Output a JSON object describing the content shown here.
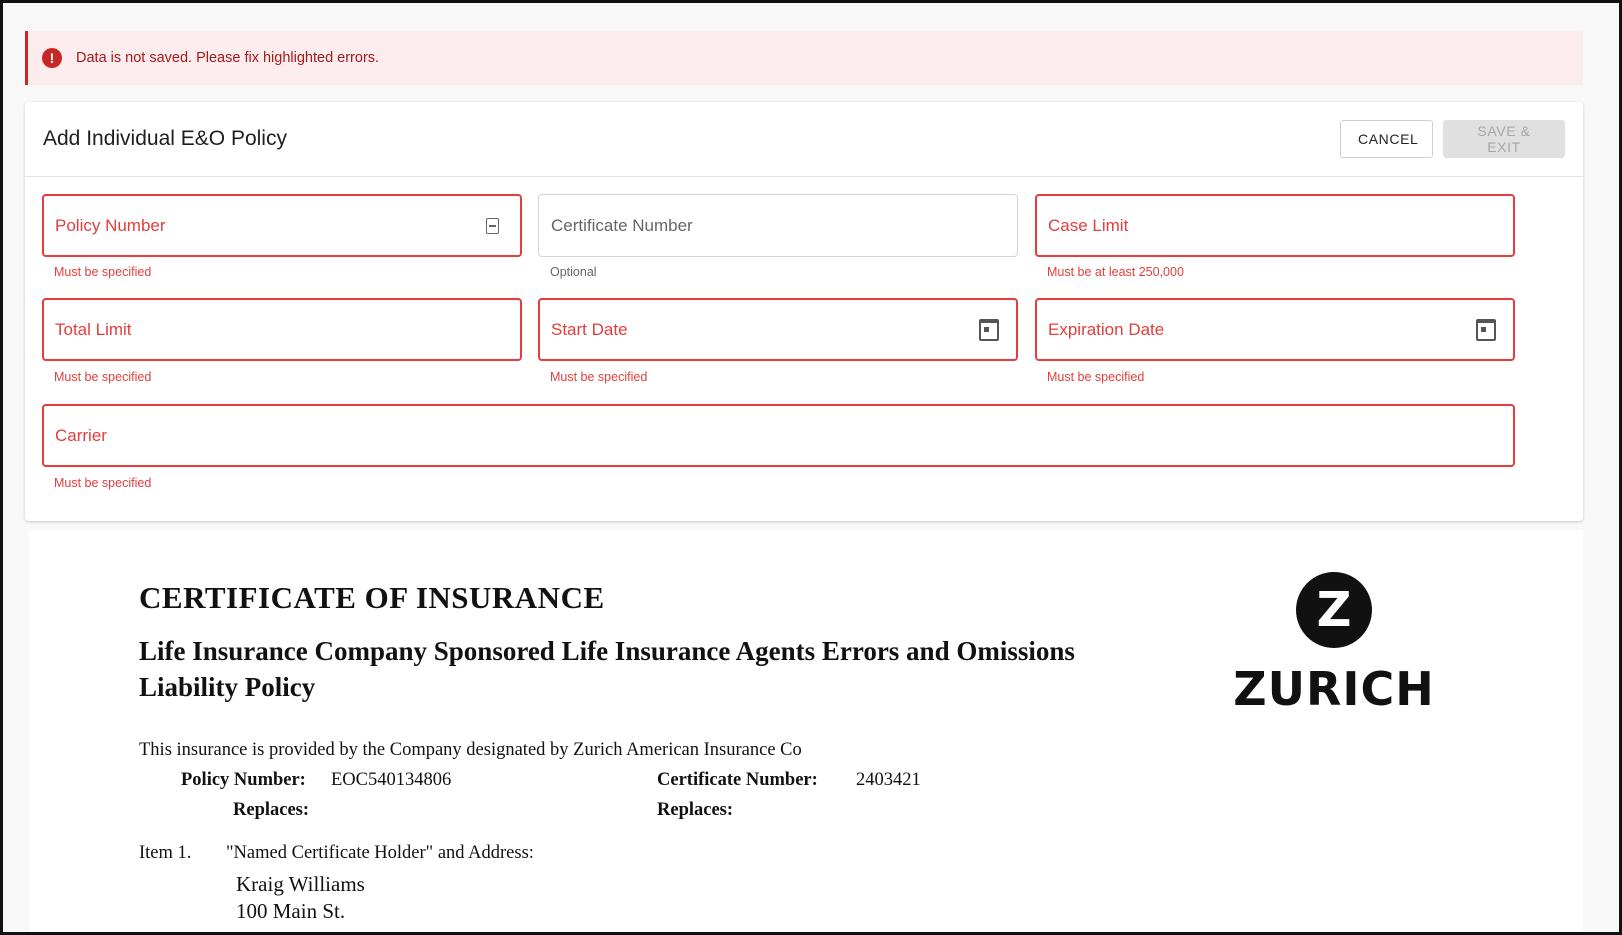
{
  "banner": {
    "icon": "error-icon",
    "message": "Data is not saved. Please fix highlighted errors."
  },
  "form": {
    "title": "Add Individual E&O Policy",
    "cancel_label": "CANCEL",
    "save_label": "SAVE & EXIT",
    "fields": {
      "policy_number": {
        "label": "Policy Number",
        "helper": "Must be specified",
        "icon": "contact-card-icon"
      },
      "certificate_number": {
        "label": "Certificate Number",
        "helper": "Optional"
      },
      "case_limit": {
        "label": "Case Limit",
        "helper": "Must be at least 250,000"
      },
      "total_limit": {
        "label": "Total Limit",
        "helper": "Must be specified"
      },
      "start_date": {
        "label": "Start Date",
        "helper": "Must be specified",
        "icon": "calendar-icon"
      },
      "expiration_date": {
        "label": "Expiration Date",
        "helper": "Must be specified",
        "icon": "calendar-icon"
      },
      "carrier": {
        "label": "Carrier",
        "helper": "Must be specified"
      }
    },
    "colors": {
      "error": "#e43d3d",
      "banner_bg": "#fdeced"
    }
  },
  "document": {
    "heading": "CERTIFICATE OF INSURANCE",
    "subheading": "Life Insurance Company Sponsored Life Insurance Agents Errors and Omissions Liability Policy",
    "provided_by": "This insurance is provided by the Company designated by Zurich American Insurance Co",
    "policy_number_label": "Policy Number:",
    "policy_number_value": "EOC540134806",
    "certificate_number_label": "Certificate Number:",
    "certificate_number_value": "2403421",
    "replaces_label": "Replaces:",
    "item_label": "Item 1.",
    "item_text": "\"Named Certificate Holder\" and Address:",
    "holder_name": "Kraig Williams",
    "holder_address": "100 Main St.",
    "logo_letter": "Z",
    "logo_word": "ZURICH"
  }
}
